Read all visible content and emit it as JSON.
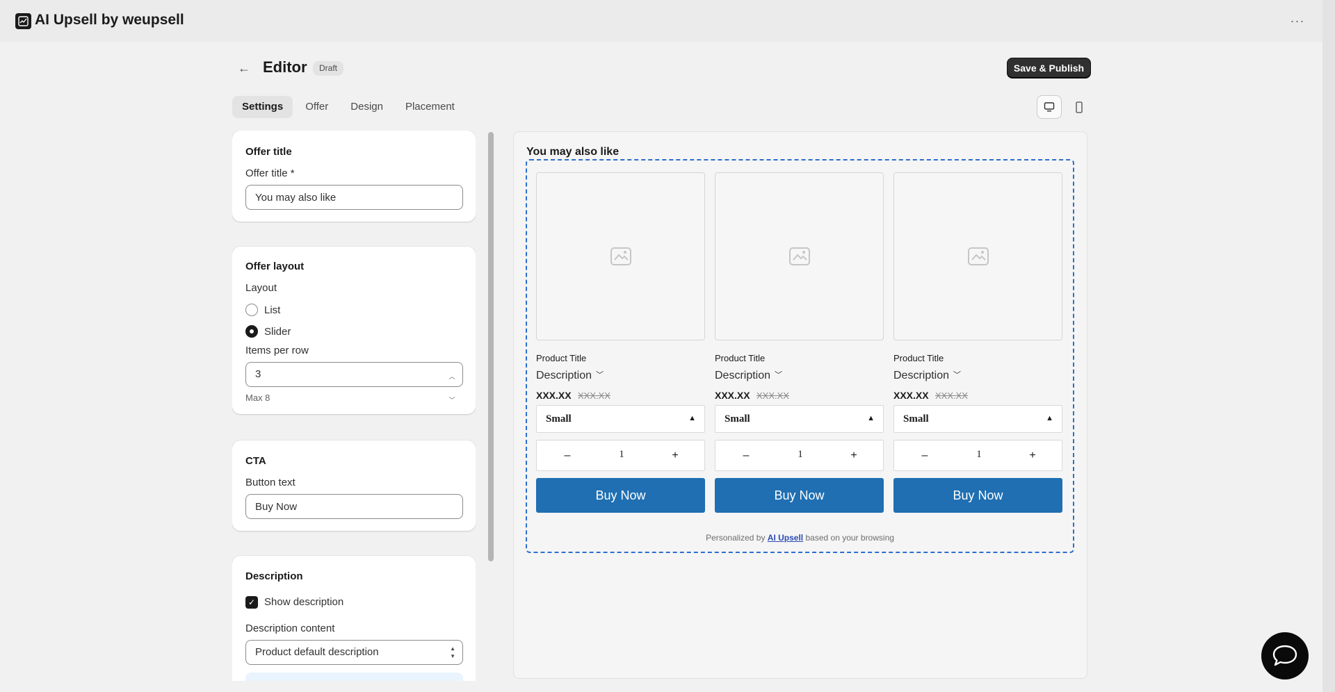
{
  "app": {
    "name": "AI Upsell by weupsell",
    "more_label": "···"
  },
  "header": {
    "back_glyph": "←",
    "title": "Editor",
    "status": "Draft",
    "save_label": "Save & Publish"
  },
  "tabs": [
    {
      "label": "Settings",
      "active": true
    },
    {
      "label": "Offer",
      "active": false
    },
    {
      "label": "Design",
      "active": false
    },
    {
      "label": "Placement",
      "active": false
    }
  ],
  "settings": {
    "offer_title": {
      "card_title": "Offer title",
      "label": "Offer title *",
      "value": "You may also like"
    },
    "offer_layout": {
      "card_title": "Offer layout",
      "layout_label": "Layout",
      "options": [
        {
          "label": "List",
          "selected": false
        },
        {
          "label": "Slider",
          "selected": true
        }
      ],
      "items_label": "Items per row",
      "items_value": "3",
      "items_help": "Max 8"
    },
    "cta": {
      "card_title": "CTA",
      "label": "Button text",
      "value": "Buy Now"
    },
    "description": {
      "card_title": "Description",
      "show_label": "Show description",
      "show_checked": true,
      "content_label": "Description content",
      "content_value": "Product default description"
    }
  },
  "preview": {
    "heading": "You may also like",
    "products": [
      {
        "title": "Product Title",
        "description": "Description",
        "price": "XXX.XX",
        "compare_price": "XXX.XX",
        "variant": "Small",
        "qty": "1",
        "button": "Buy Now"
      },
      {
        "title": "Product Title",
        "description": "Description",
        "price": "XXX.XX",
        "compare_price": "XXX.XX",
        "variant": "Small",
        "qty": "1",
        "button": "Buy Now"
      },
      {
        "title": "Product Title",
        "description": "Description",
        "price": "XXX.XX",
        "compare_price": "XXX.XX",
        "variant": "Small",
        "qty": "1",
        "button": "Buy Now"
      }
    ],
    "attribution": {
      "prefix": "Personalized by",
      "link": "AI Upsell",
      "suffix": "based on your browsing"
    },
    "qty_minus": "–",
    "qty_plus": "+"
  },
  "colors": {
    "accent_button": "#1f6fb2",
    "primary_dark": "#303030",
    "dashed_frame": "#2c6ecb"
  }
}
